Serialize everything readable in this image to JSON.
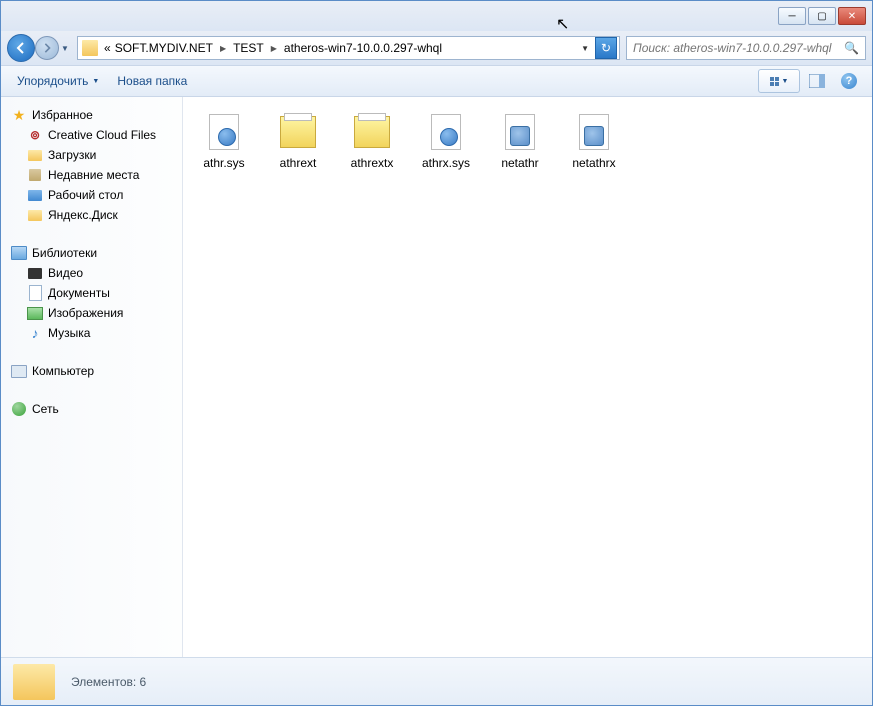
{
  "window": {
    "minimize": "─",
    "maximize": "▢",
    "close": "✕"
  },
  "breadcrumb": {
    "prefix": "«",
    "items": [
      "SOFT.MYDIV.NET",
      "TEST",
      "atheros-win7-10.0.0.297-whql"
    ]
  },
  "search": {
    "placeholder": "Поиск: atheros-win7-10.0.0.297-whql"
  },
  "toolbar": {
    "organize": "Упорядочить",
    "new_folder": "Новая папка"
  },
  "sidebar": {
    "favorites": {
      "label": "Избранное",
      "items": [
        "Creative Cloud Files",
        "Загрузки",
        "Недавние места",
        "Рабочий стол",
        "Яндекс.Диск"
      ]
    },
    "libraries": {
      "label": "Библиотеки",
      "items": [
        "Видео",
        "Документы",
        "Изображения",
        "Музыка"
      ]
    },
    "computer": {
      "label": "Компьютер"
    },
    "network": {
      "label": "Сеть"
    }
  },
  "files": [
    {
      "name": "athr.sys",
      "type": "sys"
    },
    {
      "name": "athrext",
      "type": "cat"
    },
    {
      "name": "athrextx",
      "type": "cat"
    },
    {
      "name": "athrx.sys",
      "type": "sys"
    },
    {
      "name": "netathr",
      "type": "inf"
    },
    {
      "name": "netathrx",
      "type": "inf"
    }
  ],
  "details": {
    "count_label": "Элементов: 6"
  }
}
